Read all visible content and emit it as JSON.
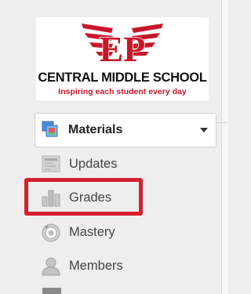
{
  "school": {
    "logo_letters": "EP",
    "name": "CENTRAL MIDDLE SCHOOL",
    "tagline": "Inspiring each student every day"
  },
  "materials": {
    "label": "Materials",
    "icon": "materials-icon"
  },
  "nav": {
    "items": [
      {
        "label": "Updates",
        "icon": "updates-icon"
      },
      {
        "label": "Grades",
        "icon": "grades-icon",
        "highlighted": true
      },
      {
        "label": "Mastery",
        "icon": "mastery-icon"
      },
      {
        "label": "Members",
        "icon": "members-icon"
      }
    ]
  },
  "colors": {
    "brand_red": "#c8172a",
    "highlight_red": "#d51f2f"
  }
}
